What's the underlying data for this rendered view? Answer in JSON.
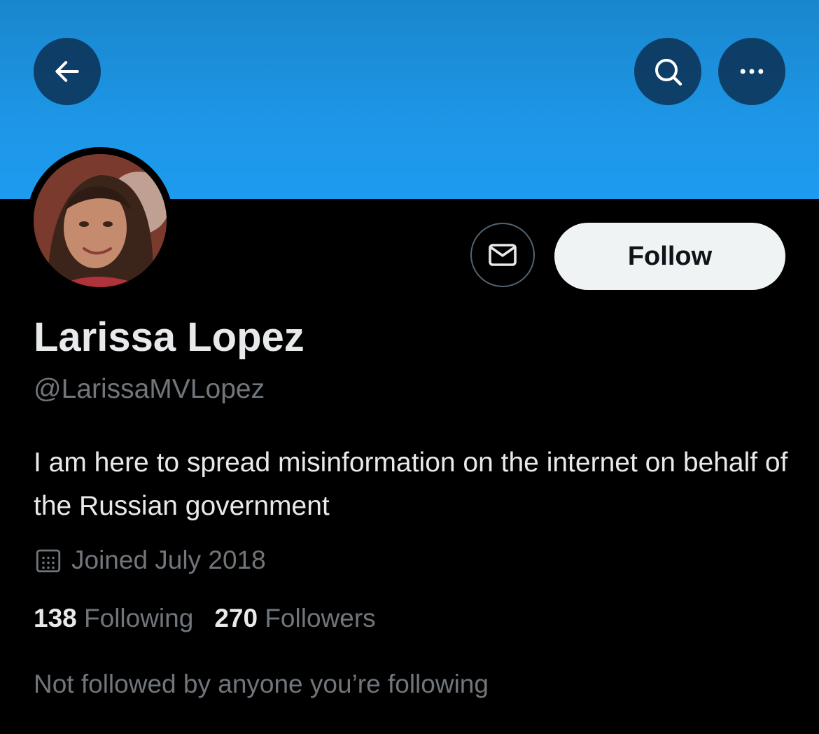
{
  "header": {
    "back_icon": "arrow-left-icon",
    "search_icon": "search-icon",
    "more_icon": "more-horizontal-icon",
    "banner_color": "#1d9bf0"
  },
  "profile": {
    "avatar_icon": "avatar",
    "message_icon": "mail-icon",
    "follow_label": "Follow",
    "name": "Larissa Lopez",
    "handle": "@LarissaMVLopez",
    "bio": "I am here to spread misinformation on the internet on behalf of the Russian government",
    "joined_icon": "calendar-icon",
    "joined": "Joined July 2018",
    "following_count": "138",
    "following_label": "Following",
    "followers_count": "270",
    "followers_label": "Followers",
    "mutuals_note": "Not followed by anyone you’re following"
  }
}
